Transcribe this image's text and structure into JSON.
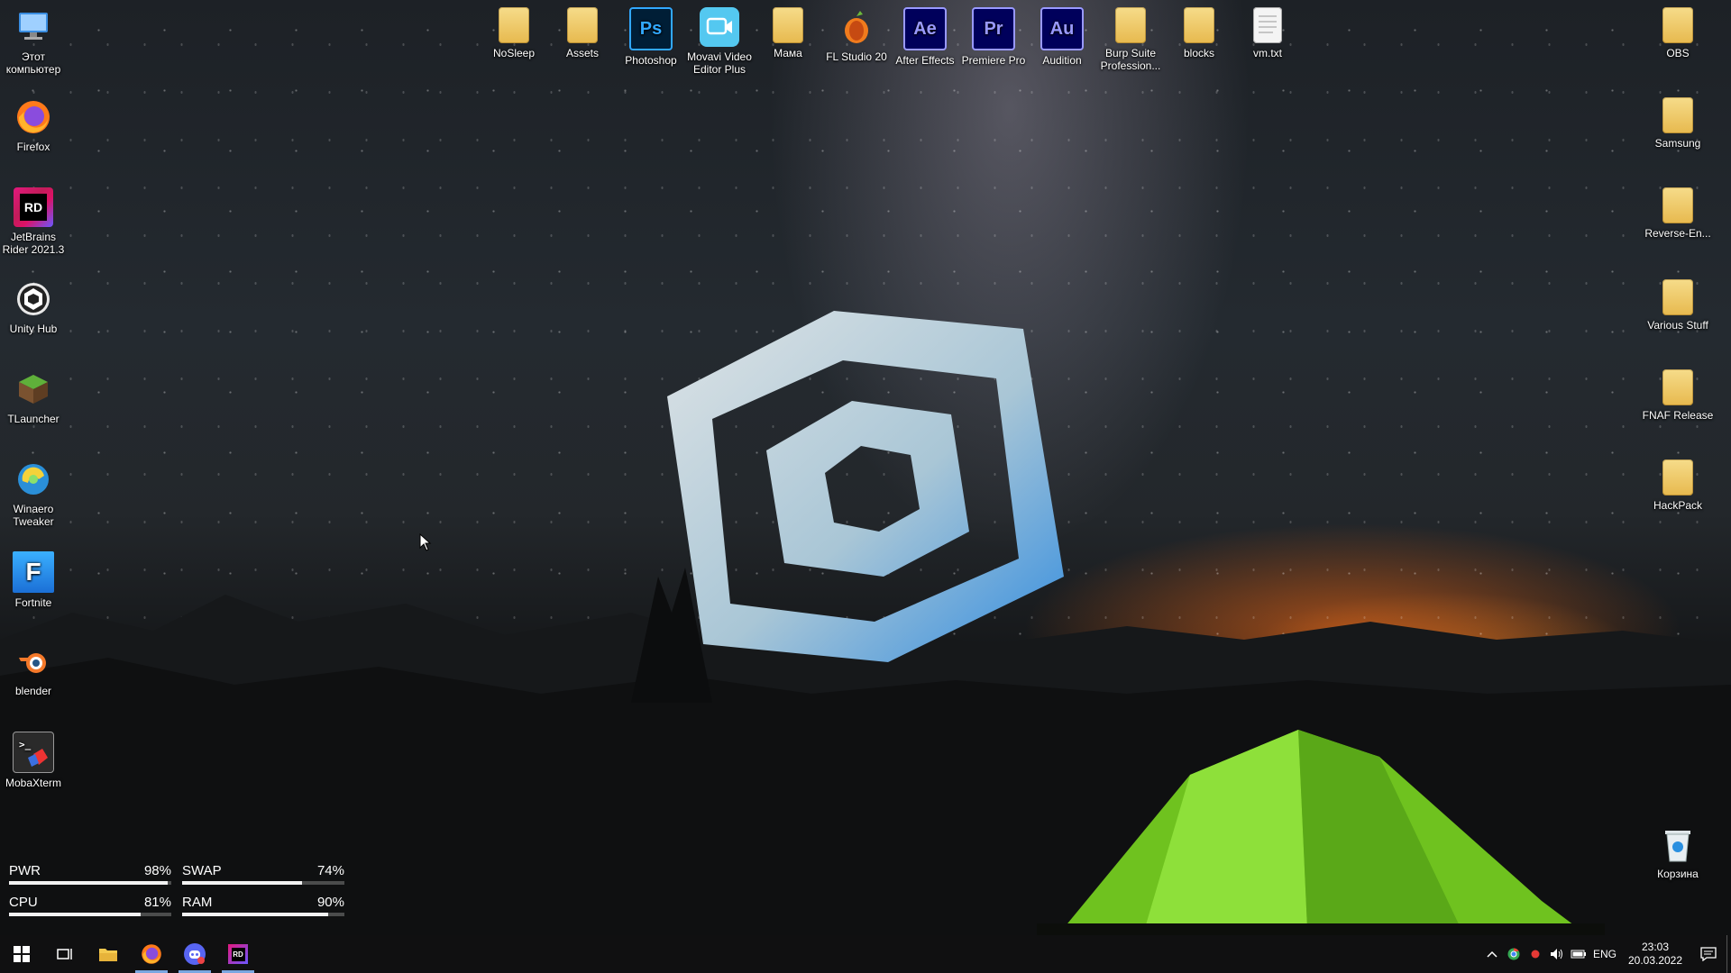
{
  "desktop": {
    "left_icons": [
      {
        "label": "Этот\nкомпьютер",
        "icon": "computer-icon"
      },
      {
        "label": "Firefox",
        "icon": "firefox-icon"
      },
      {
        "label": "JetBrains\nRider 2021.3",
        "icon": "rider-icon"
      },
      {
        "label": "Unity Hub",
        "icon": "unity-icon"
      },
      {
        "label": "TLauncher",
        "icon": "tlauncher-icon"
      },
      {
        "label": "Winaero\nTweaker",
        "icon": "winaero-icon"
      },
      {
        "label": "Fortnite",
        "icon": "fortnite-icon"
      },
      {
        "label": "blender",
        "icon": "blender-icon"
      },
      {
        "label": "MobaXterm",
        "icon": "mobaxterm-icon"
      }
    ],
    "top_icons": [
      {
        "label": "NoSleep",
        "icon": "folder-icon"
      },
      {
        "label": "Assets",
        "icon": "folder-icon"
      },
      {
        "label": "Photoshop",
        "icon": "photoshop-icon",
        "glyph": "Ps"
      },
      {
        "label": "Movavi Video\nEditor Plus",
        "icon": "movavi-icon"
      },
      {
        "label": "Мама",
        "icon": "folder-icon"
      },
      {
        "label": "FL Studio 20",
        "icon": "flstudio-icon"
      },
      {
        "label": "After Effects",
        "icon": "aftereffects-icon",
        "glyph": "Ae"
      },
      {
        "label": "Premiere Pro",
        "icon": "premiere-icon",
        "glyph": "Pr"
      },
      {
        "label": "Audition",
        "icon": "audition-icon",
        "glyph": "Au"
      },
      {
        "label": "Burp Suite\nProfession...",
        "icon": "folder-icon"
      },
      {
        "label": "blocks",
        "icon": "folder-icon"
      },
      {
        "label": "vm.txt",
        "icon": "text-file-icon"
      }
    ],
    "right_icons": [
      {
        "label": "OBS",
        "icon": "folder-icon"
      },
      {
        "label": "Samsung",
        "icon": "folder-icon"
      },
      {
        "label": "Reverse-En...",
        "icon": "folder-icon"
      },
      {
        "label": "Various Stuff",
        "icon": "folder-icon"
      },
      {
        "label": "FNAF Release",
        "icon": "folder-icon"
      },
      {
        "label": "HackPack",
        "icon": "folder-icon"
      },
      {
        "label": "Корзина",
        "icon": "recycle-bin-icon"
      }
    ]
  },
  "stats": {
    "pwr": {
      "label": "PWR",
      "value": "98%",
      "level": 0.98
    },
    "swap": {
      "label": "SWAP",
      "value": "74%",
      "level": 0.74
    },
    "cpu": {
      "label": "CPU",
      "value": "81%",
      "level": 0.81
    },
    "ram": {
      "label": "RAM",
      "value": "90%",
      "level": 0.9
    }
  },
  "taskbar": {
    "language": "ENG",
    "time": "23:03",
    "date": "20.03.2022"
  },
  "colors": {
    "taskbar": "#101011",
    "photoshop": "#31a8ff",
    "aftereffects": "#9999ff",
    "premiere": "#9999ff",
    "audition": "#00e4bb",
    "tent": "#7fd42a"
  }
}
